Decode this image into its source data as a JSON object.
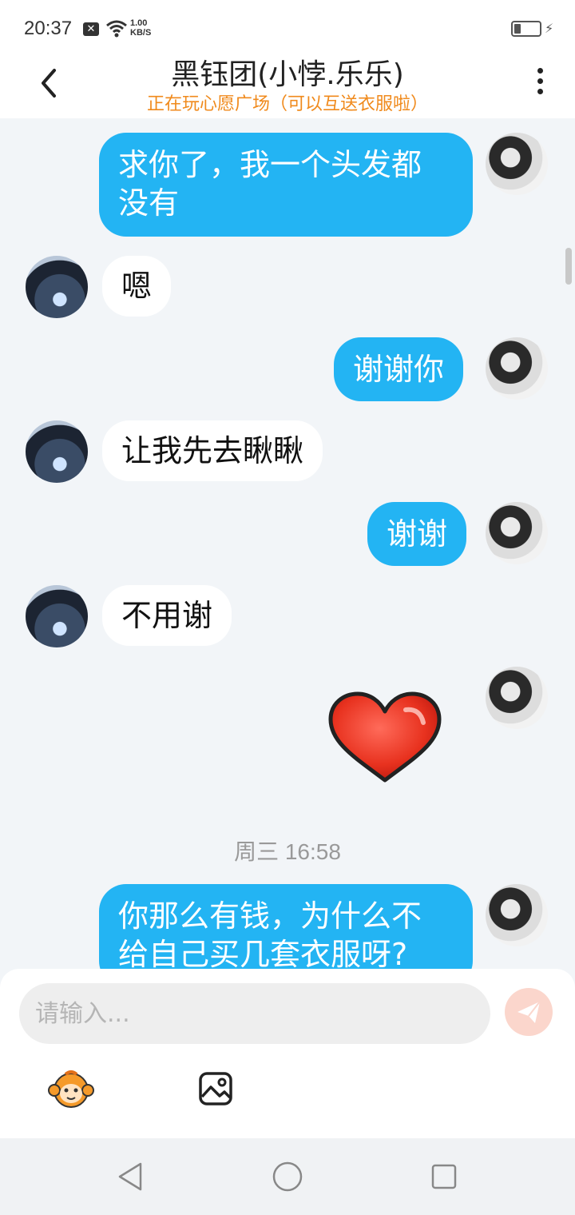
{
  "status_bar": {
    "time": "20:37",
    "notification_icon": "x-box-icon",
    "speed_value": "1.00",
    "speed_unit": "KB/S"
  },
  "header": {
    "title": "黑钰团(小悖.乐乐)",
    "subtitle": "正在玩心愿广场（可以互送衣服啦）"
  },
  "messages": [
    {
      "sender": "self",
      "text": "求你了，我一个头发都没有",
      "line1": "求你了，我一个头发都",
      "line2": "没有"
    },
    {
      "sender": "other",
      "text": "嗯"
    },
    {
      "sender": "self",
      "text": "谢谢你"
    },
    {
      "sender": "other",
      "text": "让我先去瞅瞅"
    },
    {
      "sender": "self",
      "text": "谢谢"
    },
    {
      "sender": "other",
      "text": "不用谢"
    },
    {
      "sender": "self",
      "type": "sticker",
      "sticker": "red-heart"
    },
    {
      "sender": "self",
      "text": "你那么有钱，为什么不给自己买几套衣服呀?",
      "line1": "你那么有钱，为什么不",
      "line2": "给自己买几套衣服呀?"
    }
  ],
  "time_divider": "周三 16:58",
  "composer": {
    "placeholder": "请输入...",
    "value": ""
  },
  "colors": {
    "self_bubble": "#23b4f3",
    "other_bubble": "#ffffff",
    "subtitle": "#f08a1c",
    "background": "#f2f5f8"
  }
}
